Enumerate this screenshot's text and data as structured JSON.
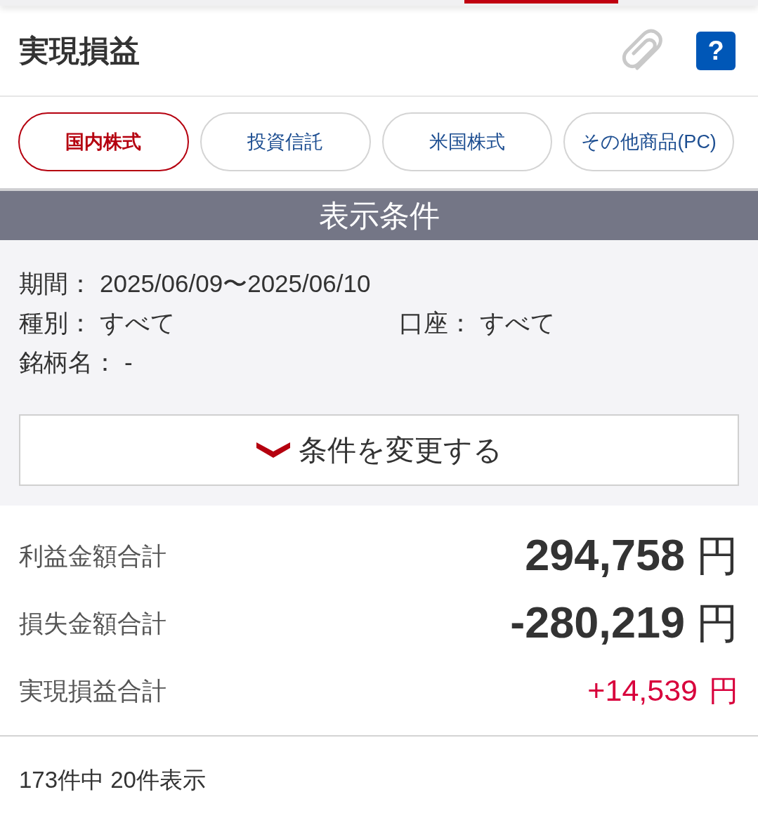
{
  "header": {
    "title": "実現損益",
    "help_button": {
      "label": "?"
    }
  },
  "tabs": [
    {
      "label": "国内株式",
      "selected": true
    },
    {
      "label": "投資信託",
      "selected": false
    },
    {
      "label": "米国株式",
      "selected": false
    },
    {
      "label": "その他商品(PC)",
      "selected": false
    }
  ],
  "conditions": {
    "heading": "表示条件",
    "rows": [
      {
        "fields": [
          {
            "label": "期間：",
            "value": "2025/06/09〜2025/06/10"
          }
        ]
      },
      {
        "fields": [
          {
            "label": "種別：",
            "value": "すべて"
          },
          {
            "label": "口座：",
            "value": "すべて"
          }
        ]
      },
      {
        "fields": [
          {
            "label": "銘柄名：",
            "value": "-"
          }
        ]
      }
    ],
    "change_button": {
      "label": "条件を変更する"
    }
  },
  "totals": [
    {
      "kind": "major",
      "label": "利益金額合計",
      "amount": "294,758",
      "unit": "円"
    },
    {
      "kind": "major",
      "label": "損失金額合計",
      "amount": "-280,219",
      "unit": "円"
    },
    {
      "kind": "net",
      "label": "実現損益合計",
      "amount": "+14,539",
      "unit": "円"
    }
  ],
  "result_count": "173件中 20件表示"
}
